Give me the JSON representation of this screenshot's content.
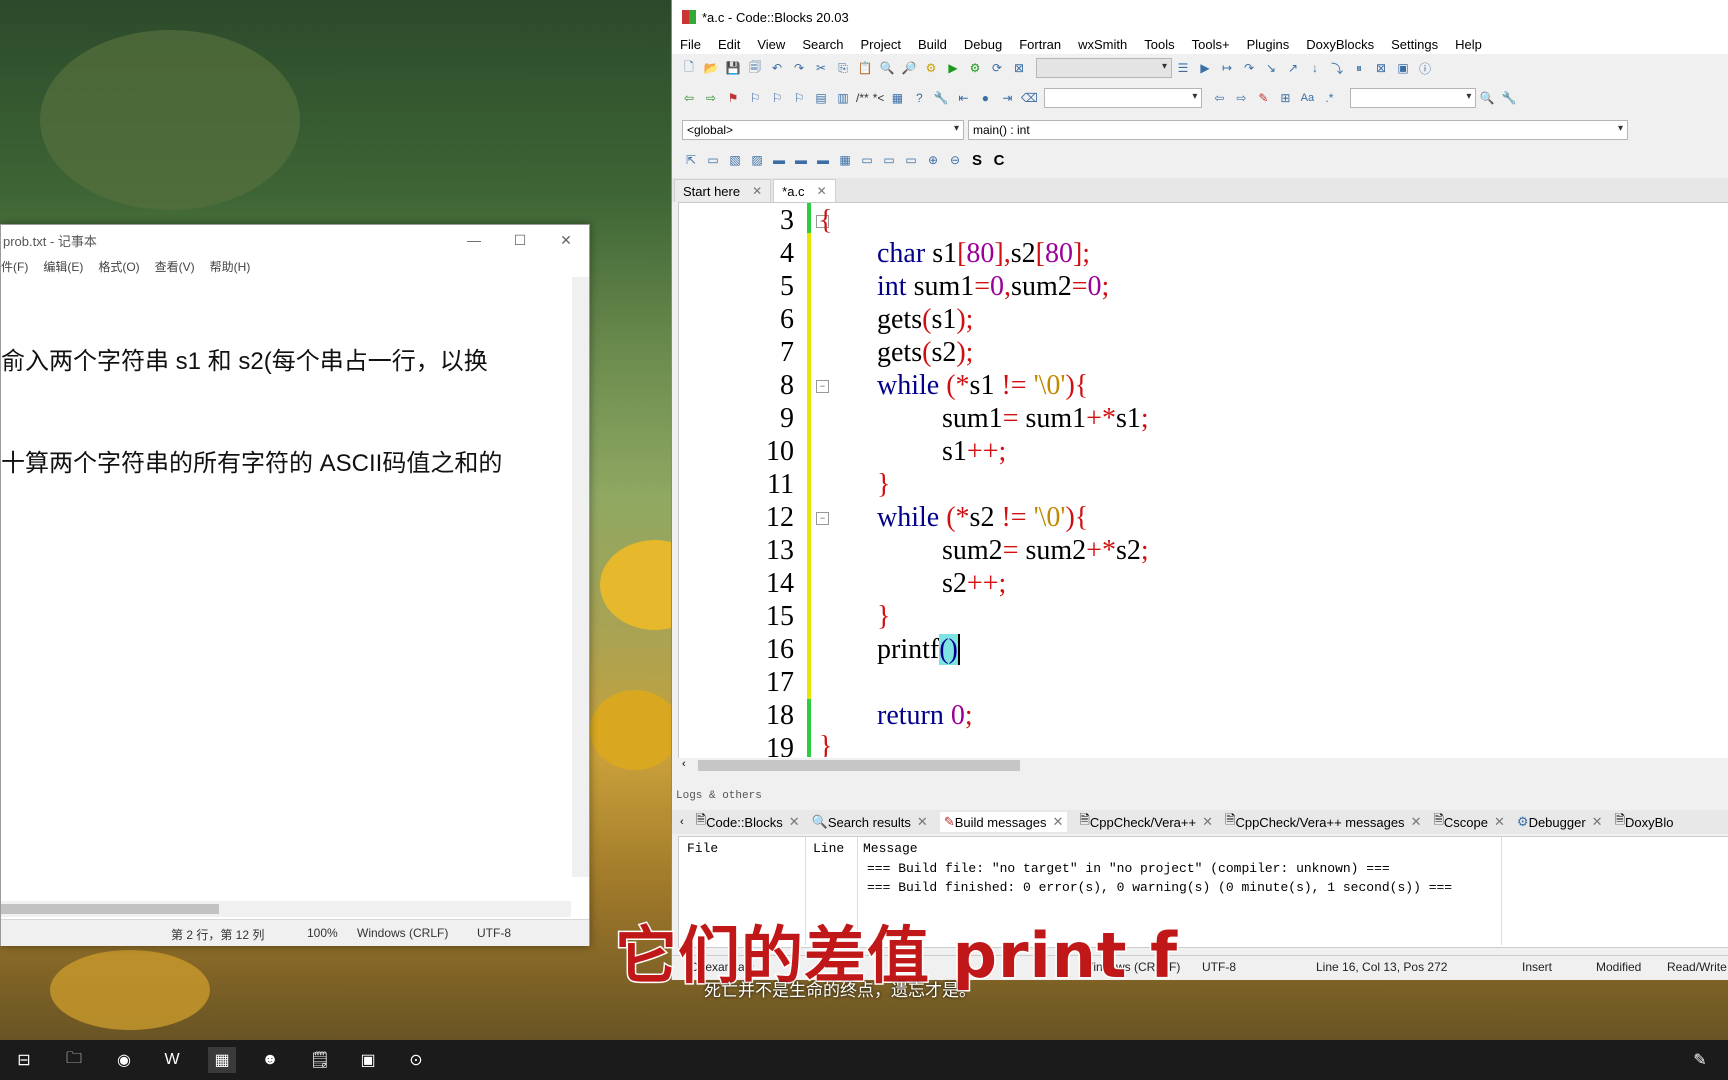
{
  "notepad": {
    "title": "prob.txt - 记事本",
    "menu": [
      "件(F)",
      "编辑(E)",
      "格式(O)",
      "查看(V)",
      "帮助(H)"
    ],
    "text_lines": [
      "俞入两个字符串 s1 和 s2(每个串占一行，以换",
      "十算两个字符串的所有字符的 ASCII码值之和的"
    ],
    "status": {
      "position": "第 2 行，第 12 列",
      "zoom": "100%",
      "line_ending": "Windows (CRLF)",
      "encoding": "UTF-8"
    }
  },
  "codeblocks": {
    "title": "*a.c - Code::Blocks 20.03",
    "menu": [
      "File",
      "Edit",
      "View",
      "Search",
      "Project",
      "Build",
      "Debug",
      "Fortran",
      "wxSmith",
      "Tools",
      "Tools+",
      "Plugins",
      "DoxyBlocks",
      "Settings",
      "Help"
    ],
    "scope_select": "<global>",
    "function_select": "main() : int",
    "toolbar_text": {
      "comment1": "/**",
      "comment2": "*<",
      "regex": ".*",
      "letter_s": "S",
      "letter_c": "C",
      "aa": "Aa"
    },
    "tabs": [
      {
        "label": "Start here",
        "close": "✕"
      },
      {
        "label": "*a.c",
        "close": "✕"
      }
    ],
    "line_numbers": [
      "3",
      "4",
      "5",
      "6",
      "7",
      "8",
      "9",
      "10",
      "11",
      "12",
      "13",
      "14",
      "15",
      "16",
      "17",
      "18",
      "19"
    ],
    "code": {
      "l3": "{",
      "l4_kw": "char",
      "l4_a": " s1",
      "l4_b": "[",
      "l4_c": "80",
      "l4_d": "],",
      "l4_e": "s2",
      "l4_f": "[",
      "l4_g": "80",
      "l4_h": "];",
      "l5_kw": "int",
      "l5_a": " sum1",
      "l5_b": "=",
      "l5_c": "0",
      "l5_d": ",",
      "l5_e": "sum2",
      "l5_f": "=",
      "l5_g": "0",
      "l5_h": ";",
      "l6_a": "gets",
      "l6_b": "(",
      "l6_c": "s1",
      "l6_d": ");",
      "l7_a": "gets",
      "l7_b": "(",
      "l7_c": "s2",
      "l7_d": ");",
      "l8_kw": "while",
      "l8_a": " ",
      "l8_b": "(*",
      "l8_c": "s1 ",
      "l8_d": "!=",
      "l8_e": " ",
      "l8_f": "'\\0'",
      "l8_g": "){",
      "l9_a": "sum1",
      "l9_b": "=",
      "l9_c": " sum1",
      "l9_d": "+*",
      "l9_e": "s1",
      "l9_f": ";",
      "l10_a": "s1",
      "l10_b": "++;",
      "l11": "}",
      "l12_kw": "while",
      "l12_a": " ",
      "l12_b": "(*",
      "l12_c": "s2 ",
      "l12_d": "!=",
      "l12_e": " ",
      "l12_f": "'\\0'",
      "l12_g": "){",
      "l13_a": "sum2",
      "l13_b": "=",
      "l13_c": " sum2",
      "l13_d": "+*",
      "l13_e": "s2",
      "l13_f": ";",
      "l14_a": "s2",
      "l14_b": "++;",
      "l15": "}",
      "l16_a": "printf",
      "l16_b": "()",
      "l18_kw": "return",
      "l18_a": " ",
      "l18_b": "0",
      "l18_c": ";",
      "l19": "}"
    },
    "logs_title": "Logs & others",
    "log_tabs": [
      "Code::Blocks",
      "Search results",
      "Build messages",
      "CppCheck/Vera++",
      "CppCheck/Vera++ messages",
      "Cscope",
      "Debugger",
      "DoxyBlo"
    ],
    "log_headers": {
      "file": "File",
      "line": "Line",
      "message": "Message"
    },
    "log_messages": [
      "=== Build file: \"no target\" in \"no project\" (compiler: unknown) ===",
      "=== Build finished: 0 error(s), 0 warning(s) (0 minute(s), 1 second(s)) ==="
    ],
    "status": {
      "path": "D:\\exam\\a.c",
      "line_ending": "Windows (CR+LF)",
      "encoding": "UTF-8",
      "position": "Line 16, Col 13, Pos 272",
      "mode": "Insert",
      "modified": "Modified",
      "access": "Read/Write"
    }
  },
  "subtitle": "它们的差值 print f",
  "subtitle_small": "死亡并不是生命的终点，遗忘才是。",
  "colors": {
    "keyword": "#00008b",
    "number": "#9a009a",
    "operator": "#d01010",
    "string": "#c08a00",
    "subtitle": "#c01818"
  }
}
